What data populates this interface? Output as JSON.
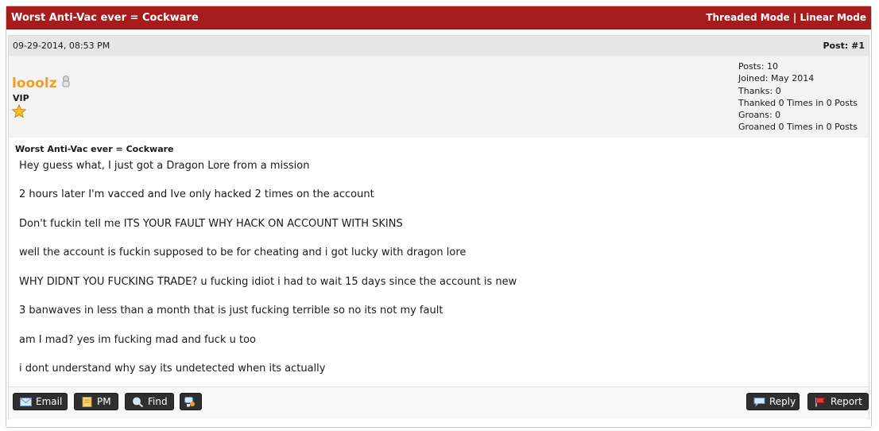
{
  "thread": {
    "title": "Worst Anti-Vac ever = Cockware",
    "threaded_mode": "Threaded Mode",
    "separator": "|",
    "linear_mode": "Linear Mode"
  },
  "post": {
    "date": "09-29-2014, 08:53 PM",
    "number": "Post: #1",
    "author": {
      "username": "looolz",
      "rank": "VIP"
    },
    "stats": [
      "Posts: 10",
      "Joined: May 2014",
      "Thanks: 0",
      "Thanked 0 Times in 0 Posts",
      "Groans: 0",
      "Groaned 0 Times in 0 Posts"
    ],
    "subject": "Worst Anti-Vac ever = Cockware",
    "lines": [
      "Hey guess what, I just got a Dragon Lore from a mission",
      "2 hours later I'm vacced and Ive only hacked 2 times on the account",
      "Don't fuckin tell me ITS YOUR FAULT WHY HACK ON ACCOUNT WITH SKINS",
      "well the account is fuckin supposed to be for cheating and i got lucky with dragon lore",
      "WHY DIDNT YOU FUCKING TRADE? u fucking idiot i had to wait 15 days since the account is new",
      "3 banwaves in less than a month that is just fucking terrible so no its not my fault",
      "am I mad? yes im fucking mad and fuck u too",
      "i dont understand why say its undetected when its actually"
    ]
  },
  "buttons": {
    "email": "Email",
    "pm": "PM",
    "find": "Find",
    "reply": "Reply",
    "report": "Report"
  },
  "icons": {
    "offline": "offline-user-icon",
    "star": "star-icon",
    "email": "envelope-icon",
    "pm": "note-icon",
    "find": "magnifier-icon",
    "quote": "multiquote-icon",
    "reply": "speech-bubble-icon",
    "report": "flag-icon"
  },
  "colors": {
    "header_red": "#a51c1c",
    "username_orange": "#f0a020",
    "button_dark": "#2f2f2f"
  }
}
